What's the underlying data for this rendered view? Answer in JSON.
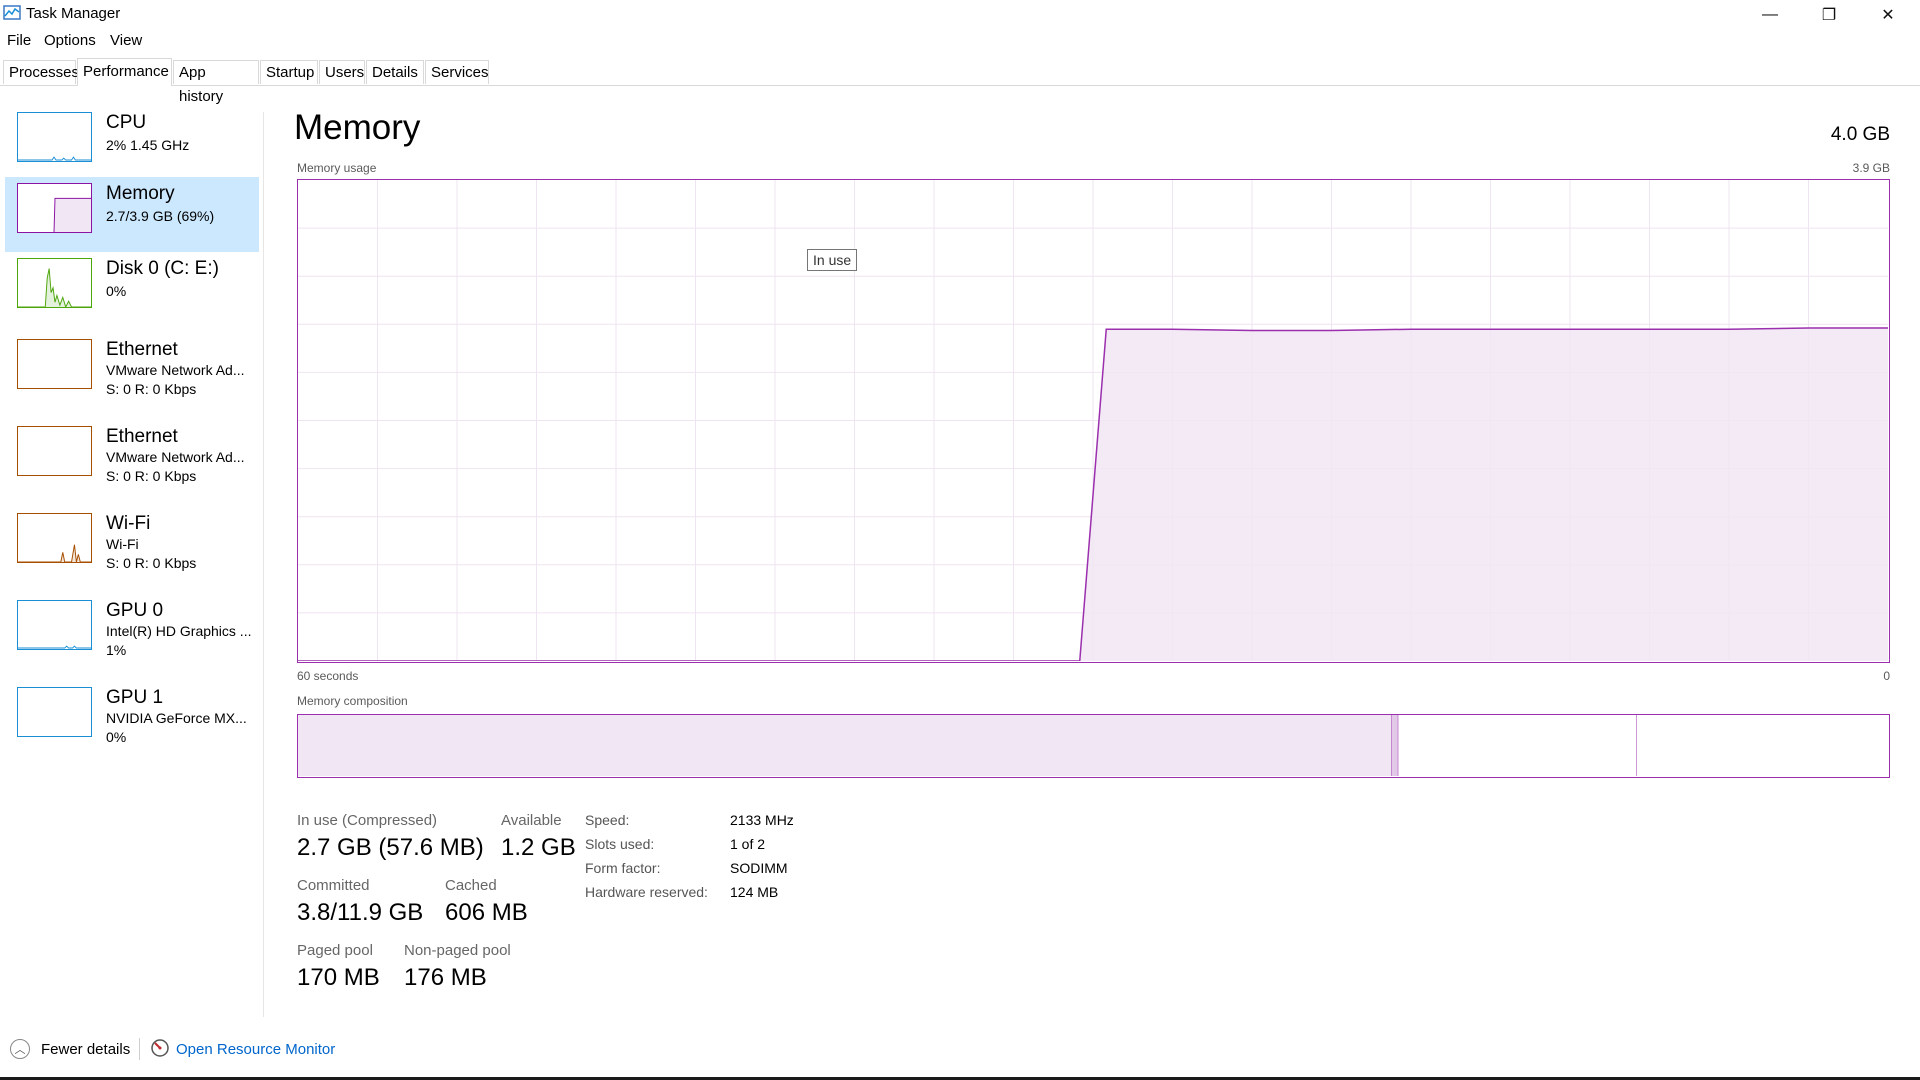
{
  "window": {
    "title": "Task Manager",
    "minimize_glyph": "—",
    "restore_glyph": "❐",
    "close_glyph": "✕"
  },
  "menu": [
    "File",
    "Options",
    "View"
  ],
  "tabs": [
    "Processes",
    "Performance",
    "App history",
    "Startup",
    "Users",
    "Details",
    "Services"
  ],
  "active_tab": "Performance",
  "sidebar": {
    "items": [
      {
        "title": "CPU",
        "line1": "2%  1.45 GHz",
        "line2": "",
        "color": "#1a8fd6",
        "icon": "cpu-thumbnail"
      },
      {
        "title": "Memory",
        "line1": "2.7/3.9 GB (69%)",
        "line2": "",
        "color": "#8b14a5",
        "icon": "memory-thumbnail"
      },
      {
        "title": "Disk 0 (C: E:)",
        "line1": "0%",
        "line2": "",
        "color": "#4da60c",
        "icon": "disk-thumbnail"
      },
      {
        "title": "Ethernet",
        "line1": "VMware Network Ad...",
        "line2": "S: 0 R: 0 Kbps",
        "color": "#a74f01",
        "icon": "ethernet-thumbnail"
      },
      {
        "title": "Ethernet",
        "line1": "VMware Network Ad...",
        "line2": "S: 0 R: 0 Kbps",
        "color": "#a74f01",
        "icon": "ethernet-thumbnail"
      },
      {
        "title": "Wi-Fi",
        "line1": "Wi-Fi",
        "line2": "S: 0 R: 0 Kbps",
        "color": "#a74f01",
        "icon": "wifi-thumbnail"
      },
      {
        "title": "GPU 0",
        "line1": "Intel(R) HD Graphics ...",
        "line2": "1%",
        "color": "#1a8fd6",
        "icon": "gpu-thumbnail"
      },
      {
        "title": "GPU 1",
        "line1": "NVIDIA GeForce MX...",
        "line2": "0%",
        "color": "#1a8fd6",
        "icon": "gpu-thumbnail"
      }
    ],
    "selected_index": 1
  },
  "main": {
    "title": "Memory",
    "total": "4.0 GB",
    "usage_label": "Memory usage",
    "usage_max": "3.9 GB",
    "time_left": "60 seconds",
    "time_right": "0",
    "inuse_tooltip": "In use",
    "composition_label": "Memory composition",
    "accent_color": "#9b2fae"
  },
  "chart_data": {
    "type": "area",
    "title": "Memory usage",
    "xlabel": "",
    "ylabel": "",
    "x_unit": "seconds ago",
    "xlim": [
      60,
      0
    ],
    "ylim": [
      0,
      3.9
    ],
    "grid": true,
    "series": [
      {
        "name": "In use",
        "x": [
          60,
          30.5,
          29.5,
          27,
          24,
          21,
          18,
          15,
          12,
          9,
          6,
          3,
          0
        ],
        "values": [
          0,
          0,
          2.69,
          2.69,
          2.68,
          2.68,
          2.69,
          2.69,
          2.69,
          2.69,
          2.69,
          2.7,
          2.7
        ]
      }
    ]
  },
  "composition": {
    "in_use_fraction": 0.688,
    "modified_fraction": 0.004,
    "standby_fraction": 0.15,
    "free_fraction": 0.158
  },
  "stats": {
    "in_use_label": "In use (Compressed)",
    "in_use_value": "2.7 GB (57.6 MB)",
    "available_label": "Available",
    "available_value": "1.2 GB",
    "committed_label": "Committed",
    "committed_value": "3.8/11.9 GB",
    "cached_label": "Cached",
    "cached_value": "606 MB",
    "paged_label": "Paged pool",
    "paged_value": "170 MB",
    "nonpaged_label": "Non-paged pool",
    "nonpaged_value": "176 MB"
  },
  "specs": [
    {
      "label": "Speed:",
      "value": "2133 MHz"
    },
    {
      "label": "Slots used:",
      "value": "1 of 2"
    },
    {
      "label": "Form factor:",
      "value": "SODIMM"
    },
    {
      "label": "Hardware reserved:",
      "value": "124 MB"
    }
  ],
  "footer": {
    "fewer_details": "Fewer details",
    "open_monitor": "Open Resource Monitor"
  }
}
